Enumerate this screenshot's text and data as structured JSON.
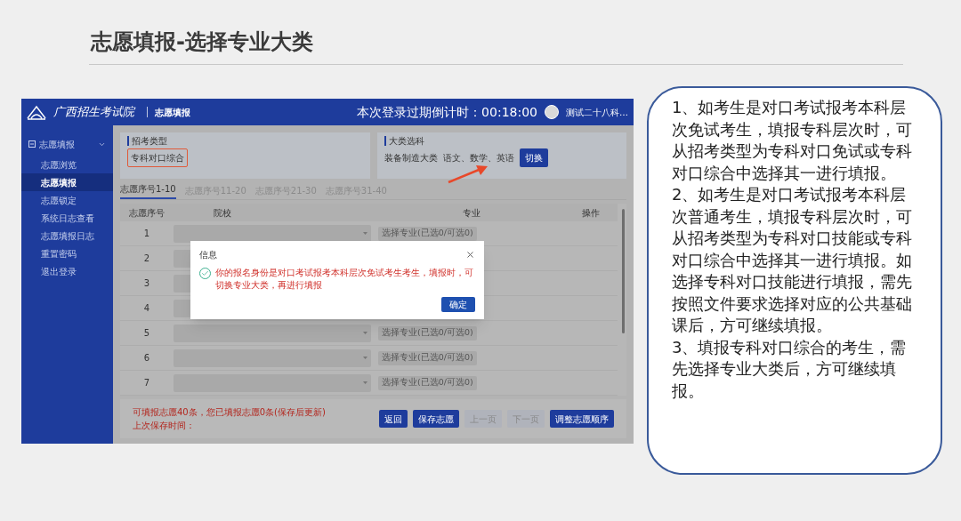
{
  "slide": {
    "title": "志愿填报-选择专业大类",
    "notes": [
      "1、如考生是对口考试报考本科层次免试考生，填报专科层次时，可从招考类型为专科对口免试或专科对口综合中选择其一进行填报。",
      "2、如考生是对口考试报考本科层次普通考生，填报专科层次时，可从招考类型为专科对口技能或专科对口综合中选择其一进行填报。如选择专科对口技能进行填报，需先按照文件要求选择对应的公共基础课后，方可继续填报。",
      "3、填报专科对口综合的考生，需先选择专业大类后，方可继续填报。"
    ]
  },
  "app": {
    "header": {
      "logo_text": "广西招生考试院",
      "section_title": "志愿填报",
      "countdown": "本次登录过期倒计时：00:18:00",
      "user_name": "测试二十八科…"
    },
    "sidebar": {
      "group": {
        "label": "志愿填报",
        "expanded": true
      },
      "items": [
        {
          "label": "志愿浏览",
          "selected": false
        },
        {
          "label": "志愿填报",
          "selected": true
        },
        {
          "label": "志愿锁定",
          "selected": false
        },
        {
          "label": "系统日志查看",
          "selected": false
        },
        {
          "label": "志愿填报日志",
          "selected": false
        },
        {
          "label": "重置密码",
          "selected": false
        },
        {
          "label": "退出登录",
          "selected": false
        }
      ]
    },
    "exam_type": {
      "label": "招考类型",
      "value": "专科对口综合"
    },
    "subject_choice": {
      "label": "大类选科",
      "category": "装备制造大类",
      "subjects": "语文、数学、英语",
      "button": "切换"
    },
    "tabs": [
      {
        "label": "志愿序号1-10",
        "selected": true
      },
      {
        "label": "志愿序号11-20",
        "selected": false
      },
      {
        "label": "志愿序号21-30",
        "selected": false
      },
      {
        "label": "志愿序号31-40",
        "selected": false
      }
    ],
    "table": {
      "columns": [
        "志愿序号",
        "院校",
        "专业",
        "操作"
      ],
      "rows": [
        {
          "seq": "1",
          "select_button": "选择专业(已选0/可选0)"
        },
        {
          "seq": "2"
        },
        {
          "seq": "3"
        },
        {
          "seq": "4"
        },
        {
          "seq": "5",
          "select_button": "选择专业(已选0/可选0)"
        },
        {
          "seq": "6",
          "select_button": "选择专业(已选0/可选0)"
        },
        {
          "seq": "7",
          "select_button": "选择专业(已选0/可选0)"
        }
      ]
    },
    "footer": {
      "notice": "可填报志愿40条，您已填报志愿0条(保存后更新)",
      "last_saved": "上次保存时间：",
      "buttons": [
        {
          "label": "返回",
          "disabled": false
        },
        {
          "label": "保存志愿",
          "disabled": false
        },
        {
          "label": "上一页",
          "disabled": true
        },
        {
          "label": "下一页",
          "disabled": true
        },
        {
          "label": "调整志愿顺序",
          "disabled": false
        }
      ]
    },
    "dialog": {
      "title": "信息",
      "message": "你的报名身份是对口考试报考本科层次免试考生考生，填报时，可切换专业大类，再进行填报",
      "confirm": "确定"
    }
  }
}
